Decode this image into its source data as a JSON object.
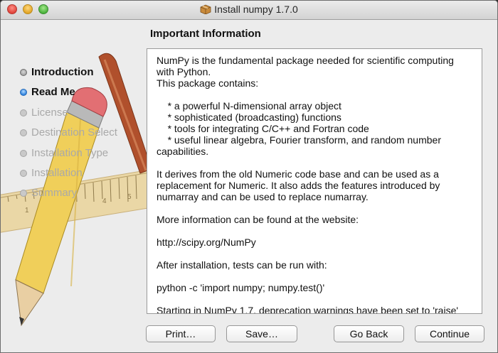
{
  "window": {
    "title": "Install numpy 1.7.0"
  },
  "sidebar": {
    "steps": [
      {
        "label": "Introduction",
        "state": "done"
      },
      {
        "label": "Read Me",
        "state": "current"
      },
      {
        "label": "License",
        "state": "pending"
      },
      {
        "label": "Destination Select",
        "state": "pending"
      },
      {
        "label": "Installation Type",
        "state": "pending"
      },
      {
        "label": "Installation",
        "state": "pending"
      },
      {
        "label": "Summary",
        "state": "pending"
      }
    ],
    "ruler_numbers": [
      "1",
      "4",
      "5"
    ]
  },
  "main": {
    "heading": "Important Information",
    "readme_text": "NumPy is the fundamental package needed for scientific computing with Python.\nThis package contains:\n\n    * a powerful N-dimensional array object\n    * sophisticated (broadcasting) functions\n    * tools for integrating C/C++ and Fortran code\n    * useful linear algebra, Fourier transform, and random number capabilities.\n\nIt derives from the old Numeric code base and can be used as a replacement for Numeric. It also adds the features introduced by numarray and can be used to replace numarray.\n\nMore information can be found at the website:\n\nhttp://scipy.org/NumPy\n\nAfter installation, tests can be run with:\n\npython -c 'import numpy; numpy.test()'\n\nStarting in NumPy 1.7, deprecation warnings have been set to 'raise' by"
  },
  "buttons": {
    "print": "Print…",
    "save": "Save…",
    "go_back": "Go Back",
    "continue": "Continue"
  }
}
